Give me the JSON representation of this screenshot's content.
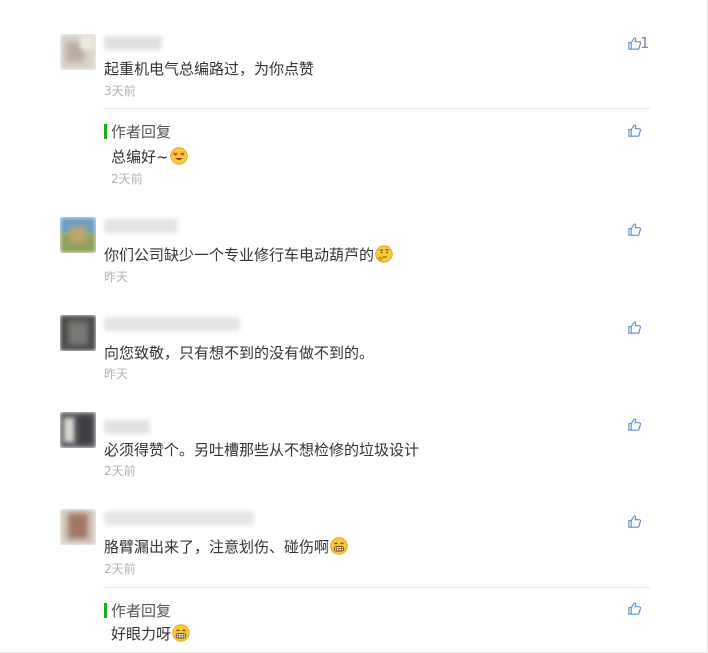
{
  "comments": [
    {
      "text": "起重机电气总编路过，为你点赞",
      "time": "3天前",
      "like_count": "1",
      "reply": {
        "label": "作者回复",
        "text": "总编好~",
        "time": "2天前"
      }
    },
    {
      "text": "你们公司缺少一个专业修行车电动葫芦的",
      "time": "昨天"
    },
    {
      "text": "向您致敬，只有想不到的没有做不到的。",
      "time": "昨天"
    },
    {
      "text": "必须得赞个。另吐槽那些从不想检修的垃圾设计",
      "time": "2天前"
    },
    {
      "text": "胳臂漏出来了，注意划伤、碰伤啊",
      "time": "2天前",
      "reply": {
        "label": "作者回复",
        "text": "好眼力呀"
      }
    }
  ],
  "icons": {
    "like": "thumbs-up-icon",
    "emoji_love": "heart-eyes-emoji",
    "emoji_thinking": "thinking-emoji",
    "emoji_grin": "grin-emoji"
  },
  "colors": {
    "reply_bar": "#1aad19",
    "time_text": "#b2b2b2",
    "like_icon": "#5a8fd0"
  }
}
